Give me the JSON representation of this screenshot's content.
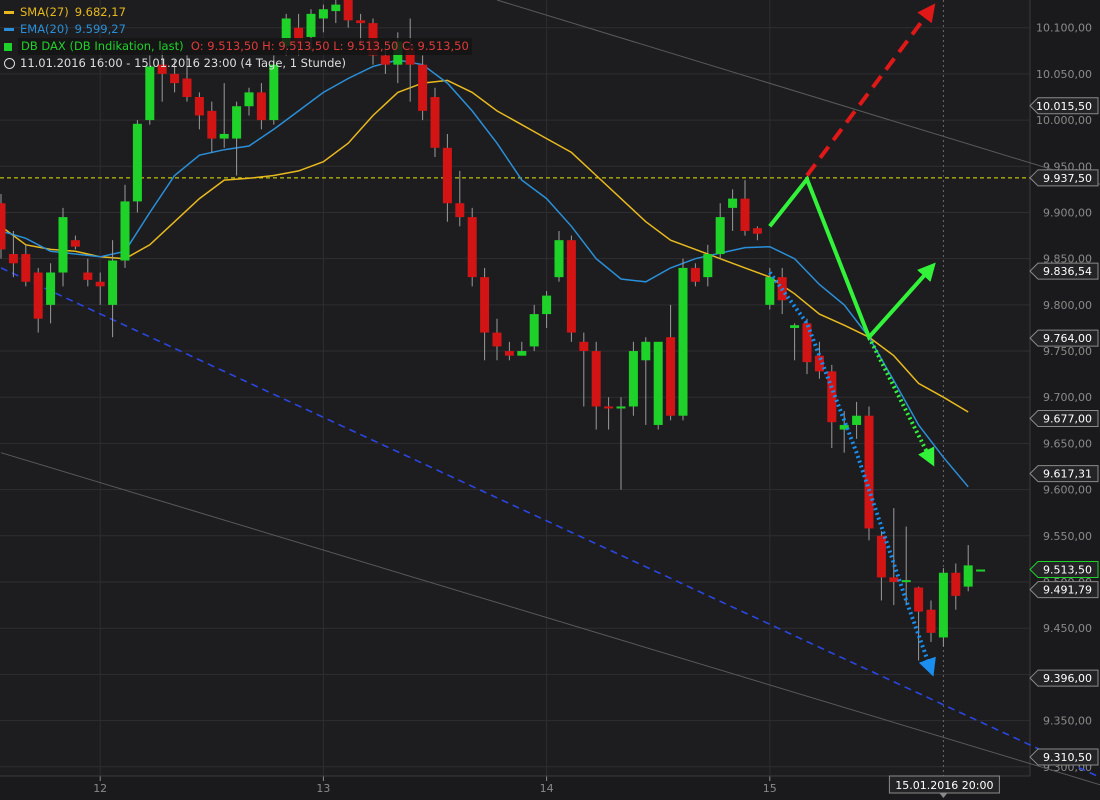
{
  "colors": {
    "background": "#1d1d1f",
    "grid": "#2e2e31",
    "axis_text": "#8a8a8a",
    "sma": "#e8b91e",
    "ema": "#2a8fd8",
    "candle_up": "#1fd22a",
    "candle_down": "#d21414",
    "wick": "#9a9a9a",
    "channel_line": "#5a5a5e",
    "support_dash": "#2a46e0",
    "target_line": "#e5e500",
    "forecast_red": "#e01818",
    "forecast_green": "#33f23a",
    "forecast_blue": "#1a8ff0"
  },
  "legend": {
    "sma_label": "SMA(27)",
    "sma_value": "9.682,17",
    "ema_label": "EMA(20)",
    "ema_value": "9.599,27",
    "dax_label": "DB DAX (DB Indikation, last)",
    "dax_ohlc": "O: 9.513,50  H: 9.513,50  L: 9.513,50  C: 9.513,50",
    "period": "11.01.2016 16:00 - 15.01.2016 23:00 (4 Tage, 1 Stunde)"
  },
  "chart_data": {
    "type": "candlestick",
    "ylim": [
      9290,
      10130
    ],
    "y_ticks": [
      9300,
      9350,
      9400,
      9450,
      9500,
      9550,
      9600,
      9650,
      9700,
      9750,
      9800,
      9850,
      9900,
      9950,
      10000,
      10050,
      10100
    ],
    "y_tick_labels": [
      "9.300,00",
      "9.350,00",
      "9.400,00",
      "9.450,00",
      "9.500,00",
      "9.550,00",
      "9.600,00",
      "9.650,00",
      "9.700,00",
      "9.750,00",
      "9.800,00",
      "9.850,00",
      "9.900,00",
      "9.950,00",
      "10.000,00",
      "10.050,00",
      "10.100,00"
    ],
    "x_ticks": [
      {
        "label": "12",
        "i": 8
      },
      {
        "label": "13",
        "i": 26
      },
      {
        "label": "14",
        "i": 44
      },
      {
        "label": "15",
        "i": 62
      }
    ],
    "current_x_label": "15.01.2016 20:00",
    "current_x_index": 76,
    "price_tags": [
      {
        "value": 10015.5,
        "label": "10.015,50",
        "style": "plain"
      },
      {
        "value": 9937.5,
        "label": "9.937,50",
        "style": "plain"
      },
      {
        "value": 9836.54,
        "label": "9.836,54",
        "style": "plain"
      },
      {
        "value": 9764.0,
        "label": "9.764,00",
        "style": "plain"
      },
      {
        "value": 9677.0,
        "label": "9.677,00",
        "style": "plain"
      },
      {
        "value": 9617.31,
        "label": "9.617,31",
        "style": "plain"
      },
      {
        "value": 9513.5,
        "label": "9.513,50",
        "style": "green"
      },
      {
        "value": 9491.79,
        "label": "9.491,79",
        "style": "plain"
      },
      {
        "value": 9396.0,
        "label": "9.396,00",
        "style": "plain"
      },
      {
        "value": 9310.5,
        "label": "9.310,50",
        "style": "plain"
      }
    ],
    "horizontal_line": {
      "value": 9937.5
    },
    "candles": [
      {
        "o": 9910,
        "h": 9920,
        "l": 9850,
        "c": 9860
      },
      {
        "o": 9855,
        "h": 9880,
        "l": 9830,
        "c": 9845
      },
      {
        "o": 9855,
        "h": 9865,
        "l": 9820,
        "c": 9825
      },
      {
        "o": 9835,
        "h": 9840,
        "l": 9770,
        "c": 9785
      },
      {
        "o": 9800,
        "h": 9845,
        "l": 9780,
        "c": 9835
      },
      {
        "o": 9835,
        "h": 9905,
        "l": 9820,
        "c": 9895
      },
      {
        "o": 9870,
        "h": 9875,
        "l": 9860,
        "c": 9863
      },
      {
        "o": 9835,
        "h": 9850,
        "l": 9820,
        "c": 9827
      },
      {
        "o": 9825,
        "h": 9835,
        "l": 9800,
        "c": 9820
      },
      {
        "o": 9800,
        "h": 9870,
        "l": 9765,
        "c": 9848
      },
      {
        "o": 9848,
        "h": 9930,
        "l": 9840,
        "c": 9912
      },
      {
        "o": 9912,
        "h": 10000,
        "l": 9900,
        "c": 9996
      },
      {
        "o": 10000,
        "h": 10070,
        "l": 9995,
        "c": 10058
      },
      {
        "o": 10060,
        "h": 10080,
        "l": 10020,
        "c": 10050
      },
      {
        "o": 10050,
        "h": 10065,
        "l": 10030,
        "c": 10040
      },
      {
        "o": 10045,
        "h": 10070,
        "l": 10020,
        "c": 10025
      },
      {
        "o": 10025,
        "h": 10030,
        "l": 9990,
        "c": 10005
      },
      {
        "o": 10010,
        "h": 10020,
        "l": 9965,
        "c": 9980
      },
      {
        "o": 9980,
        "h": 10040,
        "l": 9970,
        "c": 9985
      },
      {
        "o": 9980,
        "h": 10020,
        "l": 9940,
        "c": 10015
      },
      {
        "o": 10015,
        "h": 10035,
        "l": 10005,
        "c": 10030
      },
      {
        "o": 10030,
        "h": 10040,
        "l": 9990,
        "c": 10000
      },
      {
        "o": 10000,
        "h": 10070,
        "l": 9995,
        "c": 10060
      },
      {
        "o": 10080,
        "h": 10115,
        "l": 10070,
        "c": 10110
      },
      {
        "o": 10100,
        "h": 10115,
        "l": 10070,
        "c": 10080
      },
      {
        "o": 10090,
        "h": 10120,
        "l": 10075,
        "c": 10115
      },
      {
        "o": 10110,
        "h": 10125,
        "l": 10095,
        "c": 10120
      },
      {
        "o": 10118,
        "h": 10130,
        "l": 10105,
        "c": 10125
      },
      {
        "o": 10130,
        "h": 10140,
        "l": 10100,
        "c": 10108
      },
      {
        "o": 10108,
        "h": 10115,
        "l": 10080,
        "c": 10105
      },
      {
        "o": 10105,
        "h": 10110,
        "l": 10060,
        "c": 10070
      },
      {
        "o": 10070,
        "h": 10080,
        "l": 10050,
        "c": 10060
      },
      {
        "o": 10060,
        "h": 10095,
        "l": 10040,
        "c": 10085
      },
      {
        "o": 10080,
        "h": 10110,
        "l": 10020,
        "c": 10060
      },
      {
        "o": 10060,
        "h": 10070,
        "l": 10000,
        "c": 10010
      },
      {
        "o": 10025,
        "h": 10035,
        "l": 9960,
        "c": 9970
      },
      {
        "o": 9970,
        "h": 9985,
        "l": 9890,
        "c": 9910
      },
      {
        "o": 9910,
        "h": 9945,
        "l": 9885,
        "c": 9895
      },
      {
        "o": 9895,
        "h": 9905,
        "l": 9820,
        "c": 9830
      },
      {
        "o": 9830,
        "h": 9840,
        "l": 9740,
        "c": 9770
      },
      {
        "o": 9770,
        "h": 9785,
        "l": 9740,
        "c": 9755
      },
      {
        "o": 9750,
        "h": 9760,
        "l": 9740,
        "c": 9745
      },
      {
        "o": 9745,
        "h": 9760,
        "l": 9745,
        "c": 9750
      },
      {
        "o": 9755,
        "h": 9800,
        "l": 9750,
        "c": 9790
      },
      {
        "o": 9790,
        "h": 9815,
        "l": 9775,
        "c": 9810
      },
      {
        "o": 9830,
        "h": 9880,
        "l": 9825,
        "c": 9870
      },
      {
        "o": 9870,
        "h": 9875,
        "l": 9760,
        "c": 9770
      },
      {
        "o": 9760,
        "h": 9770,
        "l": 9690,
        "c": 9750
      },
      {
        "o": 9750,
        "h": 9760,
        "l": 9665,
        "c": 9690
      },
      {
        "o": 9690,
        "h": 9700,
        "l": 9665,
        "c": 9688
      },
      {
        "o": 9690,
        "h": 9700,
        "l": 9600,
        "c": 9690
      },
      {
        "o": 9690,
        "h": 9760,
        "l": 9680,
        "c": 9750
      },
      {
        "o": 9740,
        "h": 9765,
        "l": 9670,
        "c": 9760
      },
      {
        "o": 9670,
        "h": 9755,
        "l": 9665,
        "c": 9760
      },
      {
        "o": 9765,
        "h": 9800,
        "l": 9675,
        "c": 9680
      },
      {
        "o": 9680,
        "h": 9850,
        "l": 9675,
        "c": 9840
      },
      {
        "o": 9840,
        "h": 9845,
        "l": 9820,
        "c": 9825
      },
      {
        "o": 9830,
        "h": 9865,
        "l": 9820,
        "c": 9855
      },
      {
        "o": 9855,
        "h": 9910,
        "l": 9850,
        "c": 9895
      },
      {
        "o": 9905,
        "h": 9925,
        "l": 9880,
        "c": 9915
      },
      {
        "o": 9915,
        "h": 9935,
        "l": 9875,
        "c": 9880
      },
      {
        "o": 9883,
        "h": 9885,
        "l": 9870,
        "c": 9877
      },
      {
        "o": 9800,
        "h": 9840,
        "l": 9795,
        "c": 9830
      },
      {
        "o": 9830,
        "h": 9840,
        "l": 9790,
        "c": 9805
      },
      {
        "o": 9775,
        "h": 9780,
        "l": 9740,
        "c": 9778
      },
      {
        "o": 9780,
        "h": 9785,
        "l": 9725,
        "c": 9738
      },
      {
        "o": 9745,
        "h": 9760,
        "l": 9720,
        "c": 9728
      },
      {
        "o": 9728,
        "h": 9735,
        "l": 9645,
        "c": 9673
      },
      {
        "o": 9665,
        "h": 9685,
        "l": 9640,
        "c": 9670
      },
      {
        "o": 9670,
        "h": 9695,
        "l": 9655,
        "c": 9680
      },
      {
        "o": 9680,
        "h": 9690,
        "l": 9545,
        "c": 9558
      },
      {
        "o": 9550,
        "h": 9555,
        "l": 9480,
        "c": 9505
      },
      {
        "o": 9505,
        "h": 9580,
        "l": 9475,
        "c": 9500
      },
      {
        "o": 9500,
        "h": 9560,
        "l": 9475,
        "c": 9502
      },
      {
        "o": 9494,
        "h": 9495,
        "l": 9415,
        "c": 9468
      },
      {
        "o": 9470,
        "h": 9480,
        "l": 9435,
        "c": 9445
      },
      {
        "o": 9440,
        "h": 9515,
        "l": 9430,
        "c": 9510
      },
      {
        "o": 9510,
        "h": 9520,
        "l": 9470,
        "c": 9485
      },
      {
        "o": 9495,
        "h": 9540,
        "l": 9490,
        "c": 9518
      },
      {
        "o": 9513.5,
        "h": 9513.5,
        "l": 9513.5,
        "c": 9513.5
      }
    ],
    "series": [
      {
        "name": "SMA(27)",
        "color_key": "sma",
        "points": [
          [
            0,
            9885
          ],
          [
            2,
            9865
          ],
          [
            4,
            9860
          ],
          [
            6,
            9858
          ],
          [
            8,
            9852
          ],
          [
            10,
            9850
          ],
          [
            12,
            9865
          ],
          [
            14,
            9890
          ],
          [
            16,
            9915
          ],
          [
            18,
            9935
          ],
          [
            20,
            9937
          ],
          [
            22,
            9940
          ],
          [
            24,
            9945
          ],
          [
            26,
            9955
          ],
          [
            28,
            9975
          ],
          [
            30,
            10005
          ],
          [
            32,
            10030
          ],
          [
            34,
            10040
          ],
          [
            36,
            10043
          ],
          [
            38,
            10030
          ],
          [
            40,
            10010
          ],
          [
            42,
            9995
          ],
          [
            44,
            9980
          ],
          [
            46,
            9965
          ],
          [
            48,
            9940
          ],
          [
            50,
            9915
          ],
          [
            52,
            9890
          ],
          [
            54,
            9870
          ],
          [
            56,
            9860
          ],
          [
            58,
            9850
          ],
          [
            60,
            9840
          ],
          [
            62,
            9830
          ],
          [
            64,
            9812
          ],
          [
            66,
            9790
          ],
          [
            68,
            9778
          ],
          [
            70,
            9765
          ],
          [
            72,
            9745
          ],
          [
            74,
            9715
          ],
          [
            76,
            9700
          ],
          [
            78,
            9684
          ]
        ]
      },
      {
        "name": "EMA(20)",
        "color_key": "ema",
        "points": [
          [
            0,
            9880
          ],
          [
            2,
            9872
          ],
          [
            4,
            9858
          ],
          [
            6,
            9855
          ],
          [
            8,
            9852
          ],
          [
            10,
            9858
          ],
          [
            12,
            9900
          ],
          [
            14,
            9940
          ],
          [
            16,
            9962
          ],
          [
            18,
            9968
          ],
          [
            20,
            9972
          ],
          [
            22,
            9990
          ],
          [
            24,
            10010
          ],
          [
            26,
            10030
          ],
          [
            28,
            10045
          ],
          [
            30,
            10058
          ],
          [
            32,
            10065
          ],
          [
            34,
            10060
          ],
          [
            36,
            10040
          ],
          [
            38,
            10010
          ],
          [
            40,
            9975
          ],
          [
            42,
            9935
          ],
          [
            44,
            9915
          ],
          [
            46,
            9885
          ],
          [
            48,
            9850
          ],
          [
            50,
            9828
          ],
          [
            52,
            9825
          ],
          [
            54,
            9840
          ],
          [
            56,
            9850
          ],
          [
            58,
            9856
          ],
          [
            60,
            9862
          ],
          [
            62,
            9863
          ],
          [
            64,
            9850
          ],
          [
            66,
            9822
          ],
          [
            68,
            9800
          ],
          [
            70,
            9765
          ],
          [
            72,
            9718
          ],
          [
            74,
            9670
          ],
          [
            76,
            9635
          ],
          [
            78,
            9603
          ]
        ]
      }
    ],
    "channel_lines": [
      {
        "from": [
          0,
          9840
        ],
        "to": [
          90,
          9280
        ],
        "style": "dashed",
        "color_key": "support_dash"
      },
      {
        "from": [
          0,
          9640
        ],
        "to": [
          90,
          9275
        ],
        "style": "solid",
        "color_key": "channel_line"
      },
      {
        "from": [
          40,
          10130
        ],
        "to": [
          90,
          9925
        ],
        "style": "solid",
        "color_key": "channel_line"
      }
    ],
    "forecast_paths": [
      {
        "points": [
          [
            62,
            9885
          ],
          [
            65,
            9936
          ],
          [
            70,
            9765
          ],
          [
            75,
            9840
          ]
        ],
        "style": "solid",
        "color_key": "forecast_green",
        "arrow": true
      },
      {
        "points": [
          [
            65,
            9940
          ],
          [
            75,
            10120
          ]
        ],
        "style": "dashed",
        "color_key": "forecast_red",
        "arrow": true
      },
      {
        "points": [
          [
            70,
            9765
          ],
          [
            75,
            9632
          ]
        ],
        "style": "dotted",
        "color_key": "forecast_green",
        "arrow": true
      },
      {
        "points": [
          [
            62,
            9835
          ],
          [
            65,
            9780
          ],
          [
            67,
            9710
          ],
          [
            69,
            9640
          ],
          [
            71,
            9560
          ],
          [
            73,
            9480
          ],
          [
            75,
            9405
          ]
        ],
        "style": "dotted",
        "color_key": "forecast_blue",
        "arrow": true
      }
    ]
  }
}
